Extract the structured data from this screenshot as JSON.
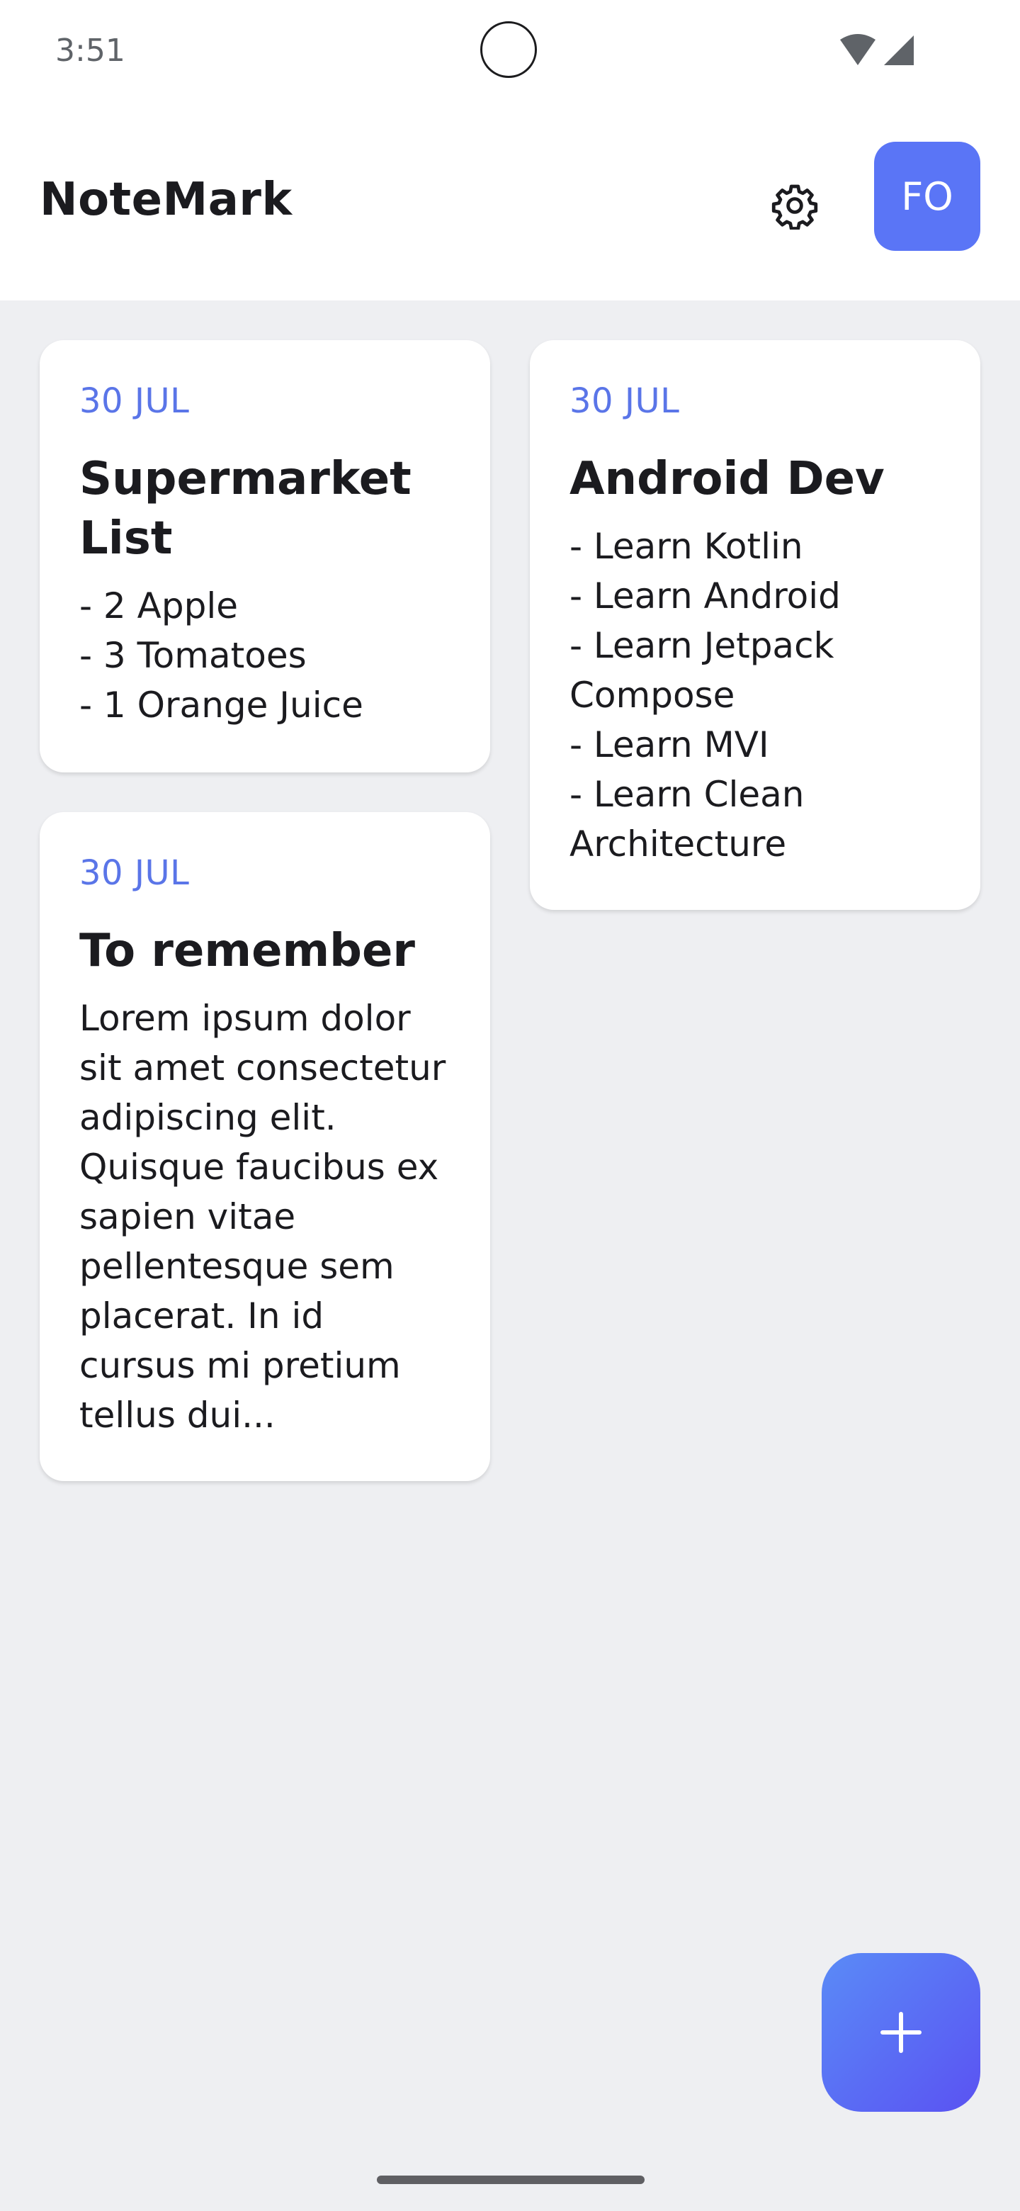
{
  "status_bar": {
    "time": "3:51",
    "icons": [
      "wifi-icon",
      "cellular-signal-icon"
    ]
  },
  "top_bar": {
    "title": "NoteMark",
    "settings_icon": "gear-icon",
    "avatar_initials": "FO"
  },
  "notes": [
    {
      "date": "30 JUL",
      "title": "Supermarket List",
      "body": "- 2 Apple\n- 3 Tomatoes\n- 1 Orange Juice"
    },
    {
      "date": "30 JUL",
      "title": "Android Dev",
      "body": "- Learn Kotlin\n- Learn Android\n- Learn Jetpack Compose\n- Learn MVI\n- Learn Clean Architecture"
    },
    {
      "date": "30 JUL",
      "title": "To remember",
      "body": "Lorem ipsum dolor sit amet consectetur adipiscing elit. Quisque faucibus ex sapien vitae pellentesque sem placerat. In id cursus mi pretium tellus dui..."
    }
  ],
  "fab": {
    "icon": "plus-icon"
  },
  "colors": {
    "accent": "#5A75F6",
    "date_text": "#5A75E8",
    "background": "#EEEFF2",
    "card": "#FFFFFF",
    "fab_gradient_start": "#5A8BF7",
    "fab_gradient_end": "#5A52F2"
  }
}
